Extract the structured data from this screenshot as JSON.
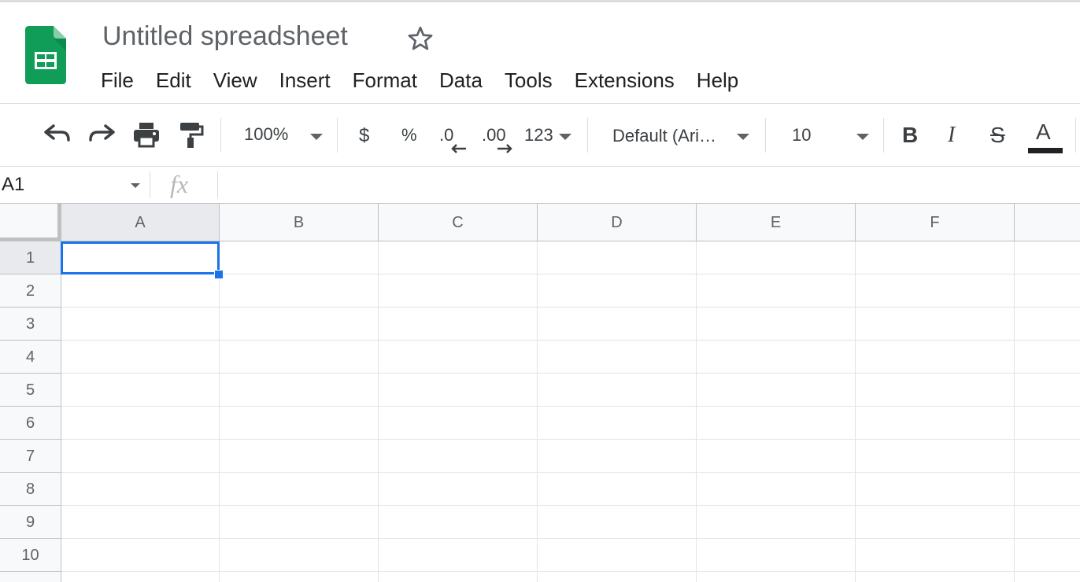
{
  "header": {
    "title": "Untitled spreadsheet",
    "menu": [
      "File",
      "Edit",
      "View",
      "Insert",
      "Format",
      "Data",
      "Tools",
      "Extensions",
      "Help"
    ]
  },
  "toolbar": {
    "zoom": "100%",
    "currency": "$",
    "percent": "%",
    "decrease_decimal": ".0",
    "increase_decimal": ".00",
    "number_format": "123",
    "font": "Default (Ari…",
    "font_size": "10",
    "bold": "B",
    "italic": "I",
    "strikethrough": "S",
    "text_color": "A"
  },
  "formula_bar": {
    "name_box": "A1",
    "fx": "fx",
    "value": ""
  },
  "grid": {
    "columns": [
      "A",
      "B",
      "C",
      "D",
      "E",
      "F"
    ],
    "rows": [
      "1",
      "2",
      "3",
      "4",
      "5",
      "6",
      "7",
      "8",
      "9",
      "10"
    ],
    "selected_cell": "A1"
  },
  "colors": {
    "logo_green": "#0f9d58",
    "selection_blue": "#1a73e8"
  }
}
